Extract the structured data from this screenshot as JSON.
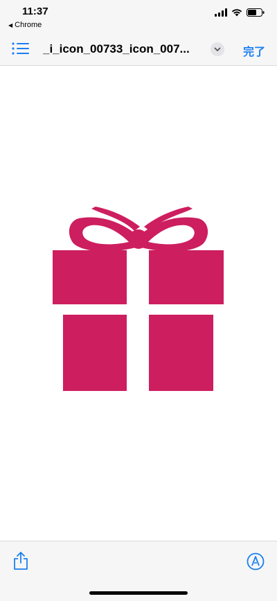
{
  "status_bar": {
    "time": "11:37",
    "back_app": "Chrome"
  },
  "nav": {
    "title": "_i_icon_00733_icon_007...",
    "done_label": "完了"
  },
  "image": {
    "subject": "gift-icon",
    "color": "#cd1e5f"
  },
  "colors": {
    "accent": "#1a7ef2",
    "bar_bg": "#f6f6f6"
  }
}
